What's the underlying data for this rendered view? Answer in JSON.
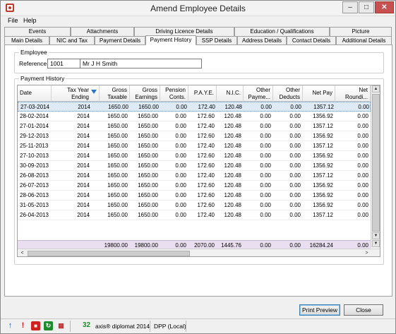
{
  "window": {
    "title": "Amend Employee Details",
    "minimize_glyph": "–",
    "maximize_glyph": "□",
    "close_glyph": "✕"
  },
  "menu": {
    "file": "File",
    "help": "Help"
  },
  "tabs": {
    "row1": [
      "Events",
      "Attachments",
      "Driving Licence Details",
      "Education / Qualifications",
      "Picture"
    ],
    "row2": [
      "Main Details",
      "NIC and Tax",
      "Payment Details",
      "Payment History",
      "SSP Details",
      "Address Details",
      "Contact Details",
      "Additional Details"
    ],
    "active": "Payment History"
  },
  "employee": {
    "group_label": "Employee",
    "reference_label": "Reference",
    "reference_value": "1001",
    "name_value": "Mr J H Smith"
  },
  "history": {
    "group_label": "Payment History",
    "columns": [
      {
        "label": "Date",
        "l2": ""
      },
      {
        "label": "Tax Year",
        "l2": "Ending"
      },
      {
        "label": "Gross",
        "l2": "Taxable"
      },
      {
        "label": "Gross",
        "l2": "Earnings"
      },
      {
        "label": "Pension",
        "l2": "Conts."
      },
      {
        "label": "P.A.Y.E.",
        "l2": ""
      },
      {
        "label": "N.I.C.",
        "l2": ""
      },
      {
        "label": "Other",
        "l2": "Payme..."
      },
      {
        "label": "Other",
        "l2": "Deducts"
      },
      {
        "label": "Net Pay",
        "l2": ""
      },
      {
        "label": "Net",
        "l2": "Roundi..."
      }
    ],
    "rows": [
      [
        "27-03-2014",
        "2014",
        "1650.00",
        "1650.00",
        "0.00",
        "172.40",
        "120.48",
        "0.00",
        "0.00",
        "1357.12",
        "0.00"
      ],
      [
        "28-02-2014",
        "2014",
        "1650.00",
        "1650.00",
        "0.00",
        "172.60",
        "120.48",
        "0.00",
        "0.00",
        "1356.92",
        "0.00"
      ],
      [
        "27-01-2014",
        "2014",
        "1650.00",
        "1650.00",
        "0.00",
        "172.40",
        "120.48",
        "0.00",
        "0.00",
        "1357.12",
        "0.00"
      ],
      [
        "29-12-2013",
        "2014",
        "1650.00",
        "1650.00",
        "0.00",
        "172.60",
        "120.48",
        "0.00",
        "0.00",
        "1356.92",
        "0.00"
      ],
      [
        "25-11-2013",
        "2014",
        "1650.00",
        "1650.00",
        "0.00",
        "172.40",
        "120.48",
        "0.00",
        "0.00",
        "1357.12",
        "0.00"
      ],
      [
        "27-10-2013",
        "2014",
        "1650.00",
        "1650.00",
        "0.00",
        "172.60",
        "120.48",
        "0.00",
        "0.00",
        "1356.92",
        "0.00"
      ],
      [
        "30-09-2013",
        "2014",
        "1650.00",
        "1650.00",
        "0.00",
        "172.60",
        "120.48",
        "0.00",
        "0.00",
        "1356.92",
        "0.00"
      ],
      [
        "26-08-2013",
        "2014",
        "1650.00",
        "1650.00",
        "0.00",
        "172.40",
        "120.48",
        "0.00",
        "0.00",
        "1357.12",
        "0.00"
      ],
      [
        "26-07-2013",
        "2014",
        "1650.00",
        "1650.00",
        "0.00",
        "172.60",
        "120.48",
        "0.00",
        "0.00",
        "1356.92",
        "0.00"
      ],
      [
        "28-06-2013",
        "2014",
        "1650.00",
        "1650.00",
        "0.00",
        "172.60",
        "120.48",
        "0.00",
        "0.00",
        "1356.92",
        "0.00"
      ],
      [
        "31-05-2013",
        "2014",
        "1650.00",
        "1650.00",
        "0.00",
        "172.60",
        "120.48",
        "0.00",
        "0.00",
        "1356.92",
        "0.00"
      ],
      [
        "26-04-2013",
        "2014",
        "1650.00",
        "1650.00",
        "0.00",
        "172.40",
        "120.48",
        "0.00",
        "0.00",
        "1357.12",
        "0.00"
      ]
    ],
    "totals": [
      "",
      "",
      "19800.00",
      "19800.00",
      "0.00",
      "2070.00",
      "1445.76",
      "0.00",
      "0.00",
      "16284.24",
      "0.00"
    ]
  },
  "buttons": {
    "print_preview": "Print Preview",
    "close": "Close"
  },
  "status": {
    "count": "32",
    "product": "axis® diplomat 2014",
    "database": "DPP (Local)"
  },
  "colors": {
    "selected_row": "#dfeaf7",
    "totals_row": "#eadff0",
    "filter_icon": "#2a74c9",
    "count_text": "#1a8c2a"
  }
}
